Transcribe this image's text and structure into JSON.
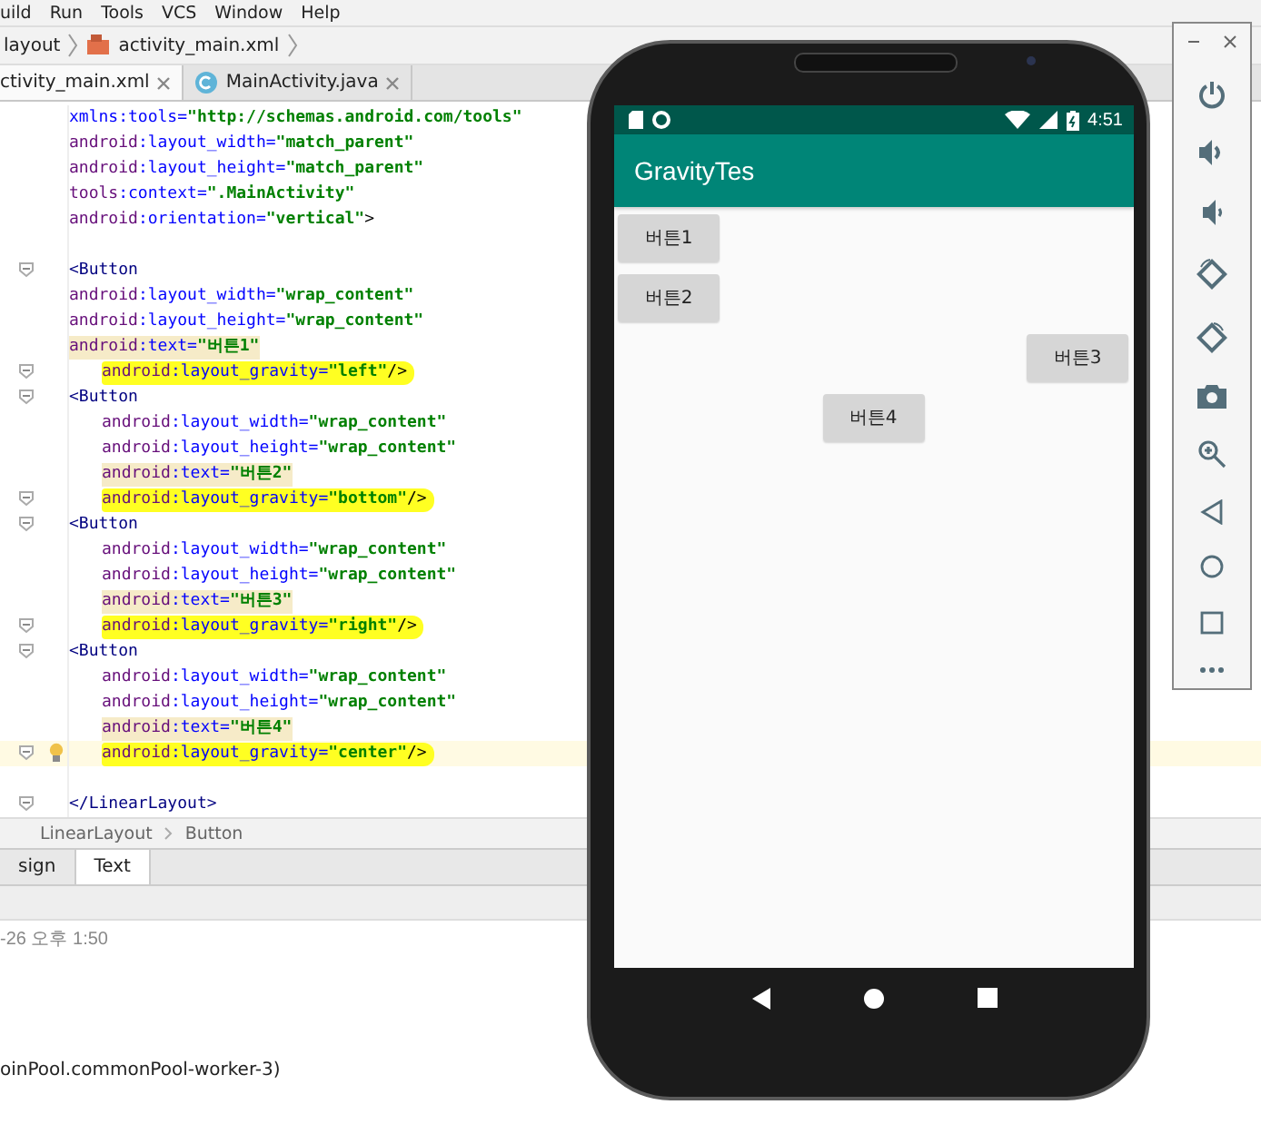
{
  "menu": [
    "uild",
    "Run",
    "Tools",
    "VCS",
    "Window",
    "Help"
  ],
  "breadcrumb": [
    "layout",
    "activity_main.xml"
  ],
  "tabs": [
    {
      "label": "ctivity_main.xml",
      "selected": true,
      "kind": "xml"
    },
    {
      "label": "MainActivity.java",
      "selected": false,
      "kind": "class"
    }
  ],
  "code_lines": [
    {
      "nested": false,
      "fold": false,
      "current": false,
      "tokens": [
        {
          "kind": "attr",
          "text": "xmlns:tools="
        },
        {
          "kind": "val",
          "text": "\"http://schemas.android.com/tools\""
        }
      ]
    },
    {
      "nested": false,
      "fold": false,
      "current": false,
      "tokens": [
        {
          "kind": "ns",
          "text": "android"
        },
        {
          "kind": "attr",
          "text": ":layout_width="
        },
        {
          "kind": "val",
          "text": "\"match_parent\""
        }
      ]
    },
    {
      "nested": false,
      "fold": false,
      "current": false,
      "tokens": [
        {
          "kind": "ns",
          "text": "android"
        },
        {
          "kind": "attr",
          "text": ":layout_height="
        },
        {
          "kind": "val",
          "text": "\"match_parent\""
        }
      ]
    },
    {
      "nested": false,
      "fold": false,
      "current": false,
      "tokens": [
        {
          "kind": "ns",
          "text": "tools"
        },
        {
          "kind": "attr",
          "text": ":context="
        },
        {
          "kind": "val",
          "text": "\".MainActivity\""
        }
      ]
    },
    {
      "nested": false,
      "fold": false,
      "current": false,
      "tokens": [
        {
          "kind": "ns",
          "text": "android"
        },
        {
          "kind": "attr",
          "text": ":orientation="
        },
        {
          "kind": "val",
          "text": "\"vertical\""
        },
        {
          "kind": "punct",
          "text": ">"
        }
      ]
    },
    {
      "current": false
    },
    {
      "nested": false,
      "fold": true,
      "current": false,
      "tokens": [
        {
          "kind": "tag",
          "text": "<Button"
        }
      ]
    },
    {
      "nested": false,
      "fold": false,
      "current": false,
      "tokens": [
        {
          "kind": "ns",
          "text": "android"
        },
        {
          "kind": "attr",
          "text": ":layout_width="
        },
        {
          "kind": "val",
          "text": "\"wrap_content\""
        }
      ]
    },
    {
      "nested": false,
      "fold": false,
      "current": false,
      "tokens": [
        {
          "kind": "ns",
          "text": "android"
        },
        {
          "kind": "attr",
          "text": ":layout_height="
        },
        {
          "kind": "val",
          "text": "\"wrap_content\""
        }
      ]
    },
    {
      "nested": false,
      "fold": false,
      "current": false,
      "kind": "shaded",
      "tokens": [
        {
          "kind": "ns",
          "text": "android"
        },
        {
          "kind": "attr",
          "text": ":text="
        },
        {
          "kind": "val",
          "text": "\"버튼1\""
        }
      ]
    },
    {
      "nested": true,
      "fold": true,
      "current": false,
      "kind": "marked",
      "tokens": [
        {
          "kind": "ns",
          "text": "android"
        },
        {
          "kind": "attr",
          "text": ":layout_gravity="
        },
        {
          "kind": "val",
          "text": "\"left\""
        },
        {
          "kind": "punct",
          "text": "/>"
        }
      ]
    },
    {
      "nested": false,
      "fold": true,
      "current": false,
      "tokens": [
        {
          "kind": "tag",
          "text": "<Button"
        }
      ]
    },
    {
      "nested": true,
      "fold": false,
      "current": false,
      "tokens": [
        {
          "kind": "ns",
          "text": "android"
        },
        {
          "kind": "attr",
          "text": ":layout_width="
        },
        {
          "kind": "val",
          "text": "\"wrap_content\""
        }
      ]
    },
    {
      "nested": true,
      "fold": false,
      "current": false,
      "tokens": [
        {
          "kind": "ns",
          "text": "android"
        },
        {
          "kind": "attr",
          "text": ":layout_height="
        },
        {
          "kind": "val",
          "text": "\"wrap_content\""
        }
      ]
    },
    {
      "nested": true,
      "fold": false,
      "current": false,
      "kind": "shaded",
      "tokens": [
        {
          "kind": "ns",
          "text": "android"
        },
        {
          "kind": "attr",
          "text": ":text="
        },
        {
          "kind": "val",
          "text": "\"버튼2\""
        }
      ]
    },
    {
      "nested": true,
      "fold": true,
      "current": false,
      "kind": "marked",
      "tokens": [
        {
          "kind": "ns",
          "text": "android"
        },
        {
          "kind": "attr",
          "text": ":layout_gravity="
        },
        {
          "kind": "val",
          "text": "\"bottom\""
        },
        {
          "kind": "punct",
          "text": "/>"
        }
      ]
    },
    {
      "nested": false,
      "fold": true,
      "current": false,
      "tokens": [
        {
          "kind": "tag",
          "text": "<Button"
        }
      ]
    },
    {
      "nested": true,
      "fold": false,
      "current": false,
      "tokens": [
        {
          "kind": "ns",
          "text": "android"
        },
        {
          "kind": "attr",
          "text": ":layout_width="
        },
        {
          "kind": "val",
          "text": "\"wrap_content\""
        }
      ]
    },
    {
      "nested": true,
      "fold": false,
      "current": false,
      "tokens": [
        {
          "kind": "ns",
          "text": "android"
        },
        {
          "kind": "attr",
          "text": ":layout_height="
        },
        {
          "kind": "val",
          "text": "\"wrap_content\""
        }
      ]
    },
    {
      "nested": true,
      "fold": false,
      "current": false,
      "kind": "shaded",
      "tokens": [
        {
          "kind": "ns",
          "text": "android"
        },
        {
          "kind": "attr",
          "text": ":text="
        },
        {
          "kind": "val",
          "text": "\"버튼3\""
        }
      ]
    },
    {
      "nested": true,
      "fold": true,
      "current": false,
      "kind": "marked",
      "tokens": [
        {
          "kind": "ns",
          "text": "android"
        },
        {
          "kind": "attr",
          "text": ":layout_gravity="
        },
        {
          "kind": "val",
          "text": "\"right\""
        },
        {
          "kind": "punct",
          "text": "/>"
        }
      ]
    },
    {
      "nested": false,
      "fold": true,
      "current": false,
      "tokens": [
        {
          "kind": "tag",
          "text": "<Button"
        }
      ]
    },
    {
      "nested": true,
      "fold": false,
      "current": false,
      "tokens": [
        {
          "kind": "ns",
          "text": "android"
        },
        {
          "kind": "attr",
          "text": ":layout_width="
        },
        {
          "kind": "val",
          "text": "\"wrap_content\""
        }
      ]
    },
    {
      "nested": true,
      "fold": false,
      "current": false,
      "tokens": [
        {
          "kind": "ns",
          "text": "android"
        },
        {
          "kind": "attr",
          "text": ":layout_height="
        },
        {
          "kind": "val",
          "text": "\"wrap_content\""
        }
      ]
    },
    {
      "nested": true,
      "fold": false,
      "current": false,
      "kind": "shaded",
      "tokens": [
        {
          "kind": "ns",
          "text": "android"
        },
        {
          "kind": "attr",
          "text": ":text="
        },
        {
          "kind": "val",
          "text": "\"버튼4\""
        }
      ]
    },
    {
      "nested": true,
      "fold": true,
      "current": true,
      "kind": "marked",
      "tokens": [
        {
          "kind": "ns",
          "text": "android"
        },
        {
          "kind": "attr",
          "text": ":layout_gravity="
        },
        {
          "kind": "val",
          "text": "\"center\""
        },
        {
          "kind": "punct",
          "text": "/>"
        }
      ]
    },
    {
      "current": false
    },
    {
      "nested": false,
      "fold": true,
      "current": false,
      "tokens": [
        {
          "kind": "tag",
          "text": "</LinearLayout>"
        }
      ]
    }
  ],
  "structure_path": [
    "LinearLayout",
    "Button"
  ],
  "editor_tabs": [
    {
      "label": "sign",
      "selected": false
    },
    {
      "label": "Text",
      "selected": true
    }
  ],
  "log_lines": [
    {
      "kind": "time",
      "text": "-26 오후 1:50"
    },
    {
      "kind": "message",
      "text": "oinPool.commonPool-worker-3)"
    }
  ],
  "emulator": {
    "time": "4:51",
    "app_title": "GravityTes",
    "buttons": [
      {
        "label": "버튼1",
        "kind": "left"
      },
      {
        "label": "버튼2",
        "kind": "bottom"
      },
      {
        "label": "버튼3",
        "kind": "right"
      },
      {
        "label": "버튼4",
        "kind": "center"
      }
    ]
  }
}
